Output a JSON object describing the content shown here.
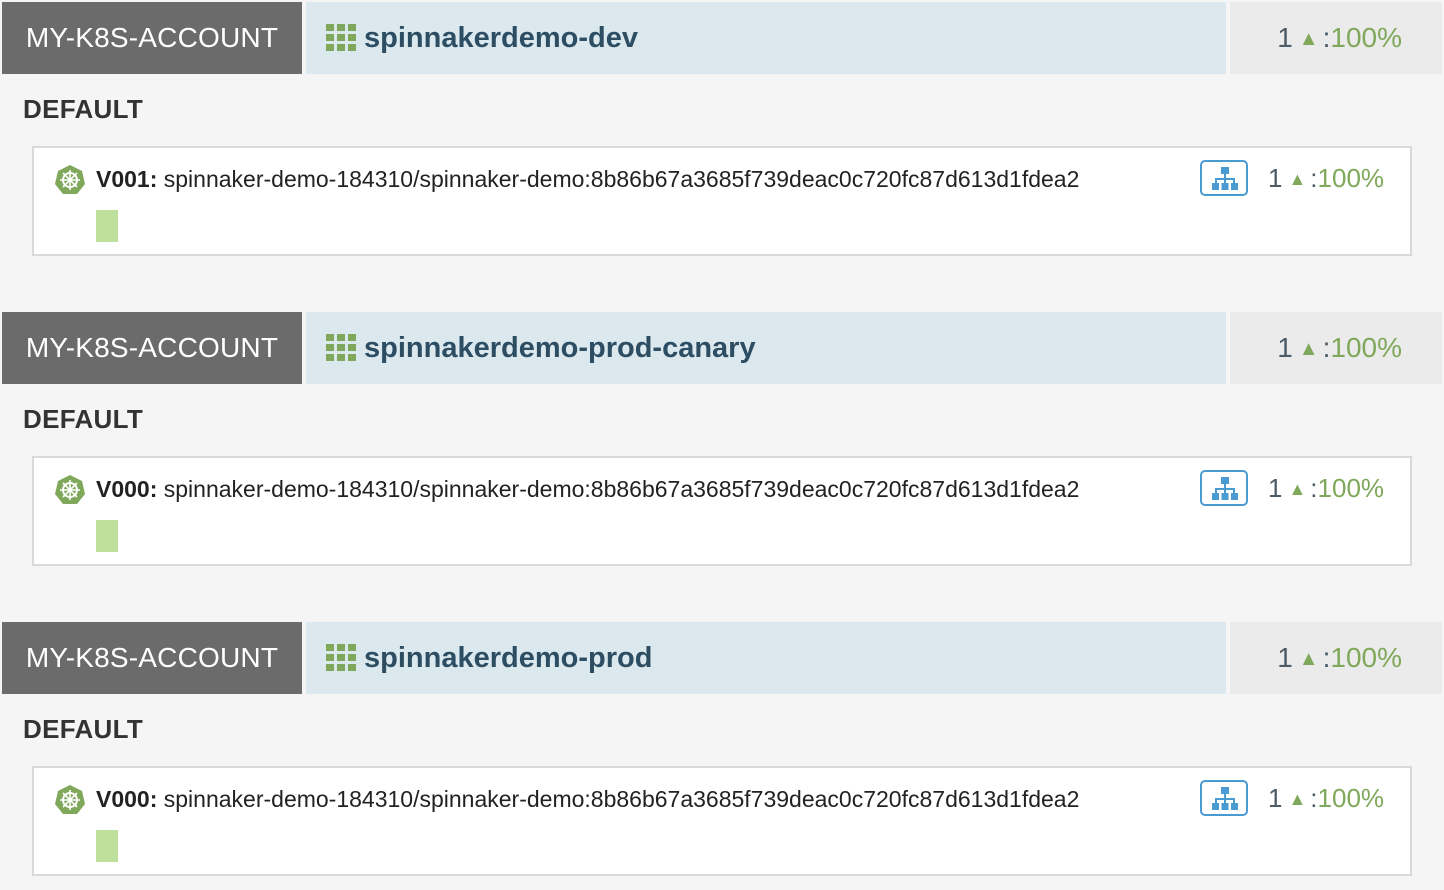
{
  "colors": {
    "account_tag_bg": "#6b6b6b",
    "cluster_bar_bg": "#dbe8ee",
    "cluster_name": "#2d4d63",
    "healthy_green": "#7fa85a",
    "instance_up": "#bfe09a",
    "lb_blue": "#4a9bd1"
  },
  "icons": {
    "cluster": "grid-icon",
    "server_group": "kubernetes-helm-icon",
    "load_balancer": "sitemap-icon",
    "health_up": "triangle-up-icon"
  },
  "clusters": [
    {
      "account": "MY-K8S-ACCOUNT",
      "name": "spinnakerdemo-dev",
      "health": {
        "count": "1",
        "separator": ":",
        "percent": "100%"
      },
      "region": "DEFAULT",
      "server_group": {
        "version": "V001:",
        "image": "spinnaker-demo-184310/spinnaker-demo:8b86b67a3685f739deac0c720fc87d613d1fdea2",
        "health": {
          "count": "1",
          "separator": ":",
          "percent": "100%"
        },
        "instances_up": 1
      }
    },
    {
      "account": "MY-K8S-ACCOUNT",
      "name": "spinnakerdemo-prod-canary",
      "health": {
        "count": "1",
        "separator": ":",
        "percent": "100%"
      },
      "region": "DEFAULT",
      "server_group": {
        "version": "V000:",
        "image": "spinnaker-demo-184310/spinnaker-demo:8b86b67a3685f739deac0c720fc87d613d1fdea2",
        "health": {
          "count": "1",
          "separator": ":",
          "percent": "100%"
        },
        "instances_up": 1
      }
    },
    {
      "account": "MY-K8S-ACCOUNT",
      "name": "spinnakerdemo-prod",
      "health": {
        "count": "1",
        "separator": ":",
        "percent": "100%"
      },
      "region": "DEFAULT",
      "server_group": {
        "version": "V000:",
        "image": "spinnaker-demo-184310/spinnaker-demo:8b86b67a3685f739deac0c720fc87d613d1fdea2",
        "health": {
          "count": "1",
          "separator": ":",
          "percent": "100%"
        },
        "instances_up": 1
      }
    }
  ]
}
